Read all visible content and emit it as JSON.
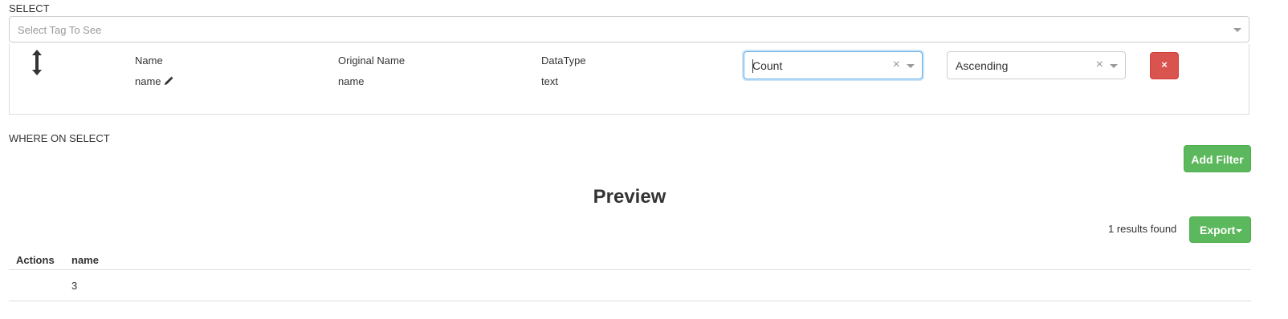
{
  "select_section": {
    "label": "SELECT",
    "tag_select": {
      "placeholder": "Select Tag To See"
    }
  },
  "column_row": {
    "headers": {
      "name": "Name",
      "original_name": "Original Name",
      "datatype": "DataType"
    },
    "values": {
      "name": "name",
      "original_name": "name",
      "datatype": "text"
    },
    "aggregate_select": {
      "value": "Count",
      "clear": "×"
    },
    "order_select": {
      "value": "Ascending",
      "clear": "×"
    },
    "remove_button": {
      "icon": "×"
    }
  },
  "where_section": {
    "label": "WHERE ON SELECT",
    "add_filter_label": "Add Filter"
  },
  "preview": {
    "title": "Preview",
    "results_found": "1 results found",
    "export_label": "Export",
    "table": {
      "columns": [
        "Actions",
        "name"
      ],
      "rows": [
        {
          "actions": "",
          "name": "3"
        }
      ]
    }
  },
  "colors": {
    "success": "#5cb85c",
    "danger": "#d9534f",
    "focus": "#66afe9",
    "border": "#cccccc"
  },
  "icons": [
    "drag-vertical-icon",
    "pencil-icon",
    "clear-icon",
    "chevron-down-icon",
    "remove-icon"
  ]
}
